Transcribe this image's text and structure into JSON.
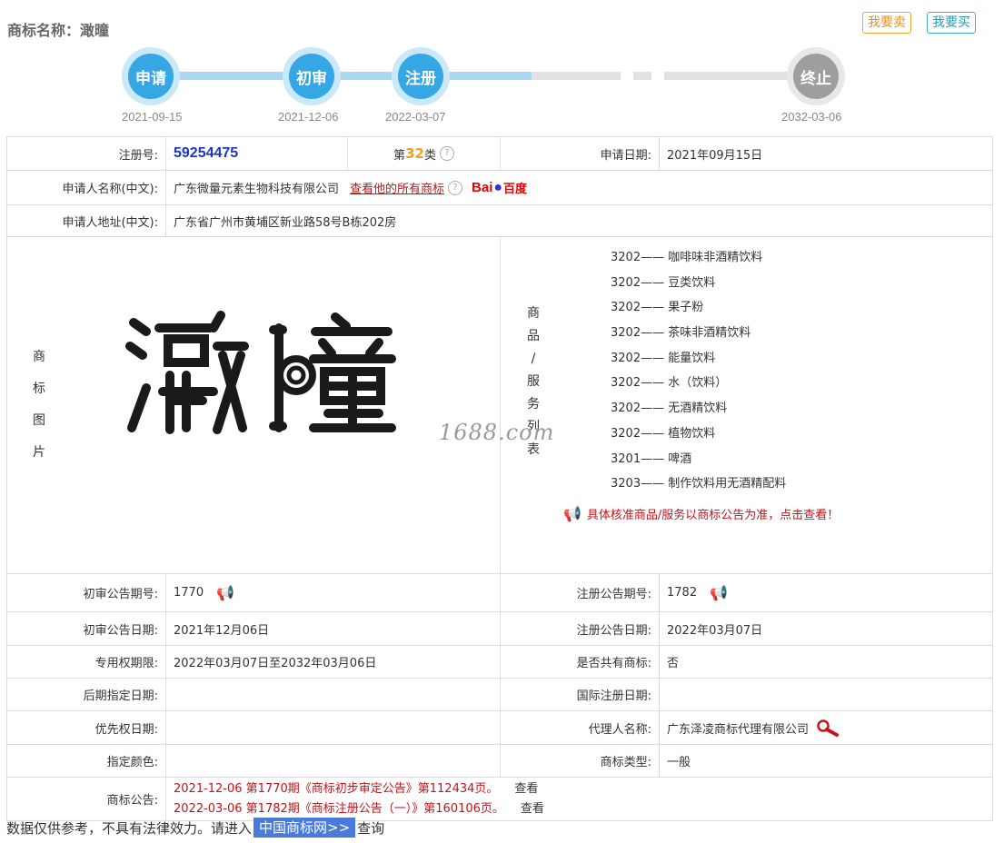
{
  "header": {
    "title": "商标名称：澉曈",
    "sell_label": "我要卖",
    "buy_label": "我要买"
  },
  "timeline": [
    {
      "label": "申请",
      "date": "2021-09-15",
      "state": "active"
    },
    {
      "label": "初审",
      "date": "2021-12-06",
      "state": "active"
    },
    {
      "label": "注册",
      "date": "2022-03-07",
      "state": "active"
    },
    {
      "label": "终止",
      "date": "2032-03-06",
      "state": "ended"
    }
  ],
  "info": {
    "reg_no_label": "注册号:",
    "reg_no": "59254475",
    "class_prefix": "第",
    "class_num": "32",
    "class_suffix": "类",
    "help_icon": "?",
    "apply_date_label": "申请日期:",
    "apply_date": "2021年09月15日",
    "applicant_label": "申请人名称(中文):",
    "applicant": "广东微量元素生物科技有限公司",
    "all_marks_link": "查看他的所有商标",
    "baidu_logo_b": "Bai",
    "baidu_logo_cn": "百度",
    "address_label": "申请人地址(中文):",
    "address": "广东省广州市黄埔区新业路58号B栋202房"
  },
  "mark_image": {
    "label_chars": [
      "商",
      "标",
      "图",
      "片"
    ],
    "mark_text": "澉曈"
  },
  "goods": {
    "label_chars": [
      "商",
      "品",
      "/",
      "服",
      "务",
      "列",
      "表"
    ],
    "items": [
      "3202—— 咖啡味非酒精饮料",
      "3202—— 豆类饮料",
      "3202—— 果子粉",
      "3202—— 茶味非酒精饮料",
      "3202—— 能量饮料",
      "3202—— 水（饮料）",
      "3202—— 无酒精饮料",
      "3202—— 植物饮料",
      "3201—— 啤酒",
      "3203—— 制作饮料用无酒精配料"
    ],
    "note": "具体核准商品/服务以商标公告为准，点击查看！"
  },
  "watermark": "1688.com",
  "details": {
    "prelim_no_label": "初审公告期号:",
    "prelim_no": "1770",
    "reg_pub_no_label": "注册公告期号:",
    "reg_pub_no": "1782",
    "prelim_date_label": "初审公告日期:",
    "prelim_date": "2021年12月06日",
    "reg_pub_date_label": "注册公告日期:",
    "reg_pub_date": "2022年03月07日",
    "exclusive_label": "专用权期限:",
    "exclusive": "2022年03月07日至2032年03月06日",
    "shared_label": "是否共有商标:",
    "shared": "否",
    "later_label": "后期指定日期:",
    "later": "",
    "intl_label": "国际注册日期:",
    "intl": "",
    "priority_label": "优先权日期:",
    "priority": "",
    "agent_label": "代理人名称:",
    "agent": "广东泽凌商标代理有限公司",
    "color_label": "指定颜色:",
    "color": "",
    "type_label": "商标类型:",
    "type": "一般",
    "notice_label": "商标公告:",
    "notices": [
      {
        "text": "2021-12-06 第1770期《商标初步审定公告》第112434页。",
        "view": "查看"
      },
      {
        "text": "2022-03-06 第1782期《商标注册公告（一）》第160106页。",
        "view": "查看"
      }
    ]
  },
  "footer": {
    "text_before": "数据仅供参考，不具有法律效力。请进入",
    "link": "中国商标网>>",
    "text_after": "查询"
  },
  "colors": {
    "timeline_active": "#37a6e4",
    "timeline_ended": "#9e9e9e",
    "reg_no": "#1d33c9",
    "class_num": "#f0a020",
    "notice_red": "#c0161b",
    "footer_link_bg": "#4a7bdb"
  }
}
